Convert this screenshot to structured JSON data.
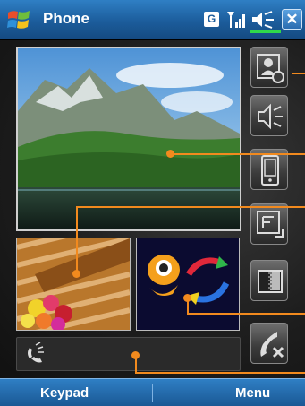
{
  "titlebar": {
    "app_title": "Phone",
    "network_indicator": "G",
    "start_icon": "windows-flag-icon",
    "signal_icon": "signal-strength-icon",
    "volume_icon": "volume-icon",
    "close_label": "✕"
  },
  "main": {
    "video_feed": "landscape-video",
    "own_video_inset": "flower-photo",
    "contact_inset": "character-with-arrows",
    "side_buttons": [
      {
        "icon": "contact-photo-icon"
      },
      {
        "icon": "speakerphone-icon"
      },
      {
        "icon": "device-icon"
      },
      {
        "icon": "display-options-icon"
      },
      {
        "icon": "image-toggle-icon"
      },
      {
        "icon": "end-call-icon"
      }
    ],
    "status_icon": "phone-call-status-icon"
  },
  "softkeys": {
    "left": "Keypad",
    "right": "Menu"
  },
  "colors": {
    "titlebar": "#1c5d9c",
    "callout": "#f28a1e"
  }
}
